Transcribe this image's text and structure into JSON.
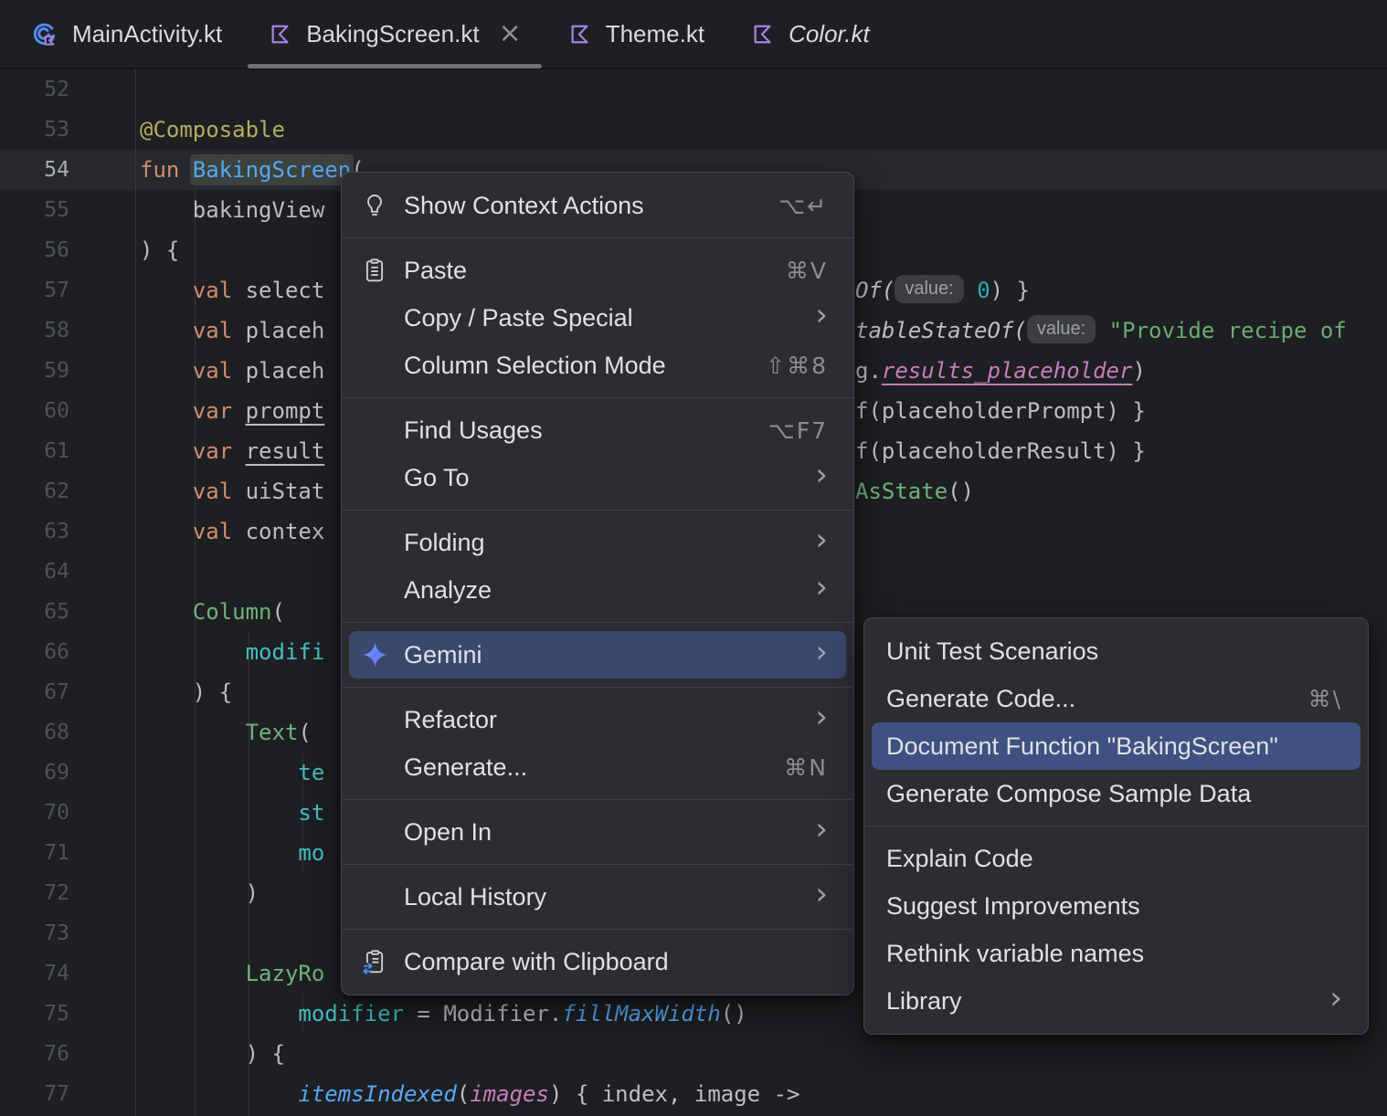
{
  "colors": {
    "editor_bg": "#1E1F22",
    "menu_bg": "#2B2D30",
    "menu_selection": "#39486B",
    "submenu_selection": "#3E5180",
    "caret_line": "#26282E",
    "kotlin_icon_purple": "#A182E3",
    "main_icon_blue": "#548AF7",
    "active_tab_underline": "#6E7278",
    "gemini_gradient": [
      "#8FB0FF",
      "#5E7CF7",
      "#9C7CF6"
    ],
    "keyword_orange": "#CF8E6D",
    "function_blue": "#56A8F5",
    "string_green": "#6AAB73",
    "named_arg_teal": "#43BFC0",
    "annotation_yellow": "#B3AE60",
    "reference_pink": "#C77DBB"
  },
  "tabs": [
    {
      "label": "MainActivity.kt",
      "icon": "kotlin-main",
      "active": false,
      "italic": false,
      "closable": false
    },
    {
      "label": "BakingScreen.kt",
      "icon": "kotlin-file",
      "active": true,
      "italic": false,
      "closable": true
    },
    {
      "label": "Theme.kt",
      "icon": "kotlin-file",
      "active": false,
      "italic": false,
      "closable": false
    },
    {
      "label": "Color.kt",
      "icon": "kotlin-file",
      "active": false,
      "italic": true,
      "closable": false
    }
  ],
  "editor": {
    "caret_line_number": "54",
    "inlay_hint": "value:",
    "lines": [
      {
        "n": "52",
        "segs": []
      },
      {
        "n": "53",
        "segs": [
          {
            "t": "@Composable",
            "s": "ann"
          }
        ]
      },
      {
        "n": "54",
        "caret": true,
        "segs": [
          {
            "t": "fun ",
            "s": "kw"
          },
          {
            "t": "BakingScreen",
            "s": "fn",
            "hl": true
          },
          {
            "t": "(",
            "s": "pln"
          }
        ]
      },
      {
        "n": "55",
        "segs": [
          {
            "t": "    bakingView",
            "s": "pln"
          }
        ]
      },
      {
        "n": "56",
        "segs": [
          {
            "t": ") {",
            "s": "pln"
          }
        ]
      },
      {
        "n": "57",
        "segs": [
          {
            "t": "    ",
            "s": "pln"
          },
          {
            "t": "val",
            "s": "kw"
          },
          {
            "t": " select",
            "s": "pln"
          }
        ],
        "right": [
          {
            "t": "Of(",
            "s": "itl"
          },
          {
            "chip": "value:"
          },
          {
            "t": " ",
            "s": "pln"
          },
          {
            "t": "0",
            "s": "num"
          },
          {
            "t": ") }",
            "s": "pln"
          }
        ]
      },
      {
        "n": "58",
        "segs": [
          {
            "t": "    ",
            "s": "pln"
          },
          {
            "t": "val",
            "s": "kw"
          },
          {
            "t": " placeh",
            "s": "pln"
          }
        ],
        "right": [
          {
            "t": "tableStateOf(",
            "s": "itl"
          },
          {
            "chip": "value:"
          },
          {
            "t": " ",
            "s": "pln"
          },
          {
            "t": "\"Provide recipe of",
            "s": "str"
          }
        ]
      },
      {
        "n": "59",
        "segs": [
          {
            "t": "    ",
            "s": "pln"
          },
          {
            "t": "val",
            "s": "kw"
          },
          {
            "t": " placeh",
            "s": "pln"
          }
        ],
        "right": [
          {
            "t": "g.",
            "s": "pln"
          },
          {
            "t": "results_placeholder",
            "s": "pinku"
          },
          {
            "t": ")",
            "s": "pln"
          }
        ]
      },
      {
        "n": "60",
        "segs": [
          {
            "t": "    ",
            "s": "pln"
          },
          {
            "t": "var",
            "s": "kw"
          },
          {
            "t": " ",
            "s": "pln"
          },
          {
            "t": "prompt",
            "s": "plnu"
          }
        ],
        "right": [
          {
            "t": "f(placeholderPrompt) }",
            "s": "pln"
          }
        ]
      },
      {
        "n": "61",
        "segs": [
          {
            "t": "    ",
            "s": "pln"
          },
          {
            "t": "var",
            "s": "kw"
          },
          {
            "t": " ",
            "s": "pln"
          },
          {
            "t": "result",
            "s": "plnu"
          }
        ],
        "right": [
          {
            "t": "f(placeholderResult) }",
            "s": "pln"
          }
        ]
      },
      {
        "n": "62",
        "segs": [
          {
            "t": "    ",
            "s": "pln"
          },
          {
            "t": "val",
            "s": "kw"
          },
          {
            "t": " uiStat",
            "s": "pln"
          }
        ],
        "right": [
          {
            "t": "AsState",
            "s": "comp"
          },
          {
            "t": "()",
            "s": "pln"
          }
        ]
      },
      {
        "n": "63",
        "segs": [
          {
            "t": "    ",
            "s": "pln"
          },
          {
            "t": "val",
            "s": "kw"
          },
          {
            "t": " contex",
            "s": "pln"
          }
        ]
      },
      {
        "n": "64",
        "segs": []
      },
      {
        "n": "65",
        "segs": [
          {
            "t": "    ",
            "s": "pln"
          },
          {
            "t": "Column",
            "s": "comp"
          },
          {
            "t": "(",
            "s": "pln"
          }
        ]
      },
      {
        "n": "66",
        "segs": [
          {
            "t": "        ",
            "s": "pln"
          },
          {
            "t": "modifi",
            "s": "named"
          }
        ]
      },
      {
        "n": "67",
        "segs": [
          {
            "t": "    ) {",
            "s": "pln"
          }
        ]
      },
      {
        "n": "68",
        "segs": [
          {
            "t": "        ",
            "s": "pln"
          },
          {
            "t": "Text",
            "s": "comp"
          },
          {
            "t": "(",
            "s": "pln"
          }
        ]
      },
      {
        "n": "69",
        "segs": [
          {
            "t": "            ",
            "s": "pln"
          },
          {
            "t": "te",
            "s": "named"
          }
        ]
      },
      {
        "n": "70",
        "segs": [
          {
            "t": "            ",
            "s": "pln"
          },
          {
            "t": "st",
            "s": "named"
          }
        ]
      },
      {
        "n": "71",
        "segs": [
          {
            "t": "            ",
            "s": "pln"
          },
          {
            "t": "mo",
            "s": "named"
          }
        ]
      },
      {
        "n": "72",
        "segs": [
          {
            "t": "        )",
            "s": "pln"
          }
        ]
      },
      {
        "n": "73",
        "segs": []
      },
      {
        "n": "74",
        "segs": [
          {
            "t": "        ",
            "s": "pln"
          },
          {
            "t": "LazyRo",
            "s": "comp"
          }
        ]
      },
      {
        "n": "75",
        "segs": [
          {
            "t": "            ",
            "s": "pln"
          },
          {
            "t": "modifier",
            "s": "named"
          },
          {
            "t": " = Modifier.",
            "s": "pln"
          },
          {
            "t": "fillMaxWidth",
            "s": "ext"
          },
          {
            "t": "()",
            "s": "pln"
          }
        ]
      },
      {
        "n": "76",
        "segs": [
          {
            "t": "        ) {",
            "s": "pln"
          }
        ]
      },
      {
        "n": "77",
        "segs": [
          {
            "t": "            ",
            "s": "pln"
          },
          {
            "t": "itemsIndexed",
            "s": "ext"
          },
          {
            "t": "(",
            "s": "pln"
          },
          {
            "t": "images",
            "s": "pink"
          },
          {
            "t": ") { index, image ->",
            "s": "pln"
          }
        ]
      }
    ]
  },
  "context_menu": {
    "items": [
      {
        "type": "item",
        "label": "Show Context Actions",
        "icon": "lightbulb",
        "shortcut": "⌥↵"
      },
      {
        "type": "sep"
      },
      {
        "type": "item",
        "label": "Paste",
        "icon": "clipboard",
        "shortcut": "⌘V"
      },
      {
        "type": "item",
        "label": "Copy / Paste Special",
        "submenu": true
      },
      {
        "type": "item",
        "label": "Column Selection Mode",
        "shortcut": "⇧⌘8"
      },
      {
        "type": "sep"
      },
      {
        "type": "item",
        "label": "Find Usages",
        "shortcut": "⌥F7"
      },
      {
        "type": "item",
        "label": "Go To",
        "submenu": true
      },
      {
        "type": "sep"
      },
      {
        "type": "item",
        "label": "Folding",
        "submenu": true
      },
      {
        "type": "item",
        "label": "Analyze",
        "submenu": true
      },
      {
        "type": "sep"
      },
      {
        "type": "item",
        "label": "Gemini",
        "icon": "gemini",
        "submenu": true,
        "selected": true
      },
      {
        "type": "sep"
      },
      {
        "type": "item",
        "label": "Refactor",
        "submenu": true
      },
      {
        "type": "item",
        "label": "Generate...",
        "shortcut": "⌘N"
      },
      {
        "type": "sep"
      },
      {
        "type": "item",
        "label": "Open In",
        "submenu": true
      },
      {
        "type": "sep"
      },
      {
        "type": "item",
        "label": "Local History",
        "submenu": true
      },
      {
        "type": "sep"
      },
      {
        "type": "item",
        "label": "Compare with Clipboard",
        "icon": "clipboard-compare"
      }
    ]
  },
  "gemini_submenu": {
    "items": [
      {
        "type": "item",
        "label": "Unit Test Scenarios"
      },
      {
        "type": "item",
        "label": "Generate Code...",
        "shortcut": "⌘\\"
      },
      {
        "type": "item",
        "label": "Document Function \"BakingScreen\"",
        "selected": true
      },
      {
        "type": "item",
        "label": "Generate Compose Sample Data"
      },
      {
        "type": "sep"
      },
      {
        "type": "item",
        "label": "Explain Code"
      },
      {
        "type": "item",
        "label": "Suggest Improvements"
      },
      {
        "type": "item",
        "label": "Rethink variable names"
      },
      {
        "type": "item",
        "label": "Library",
        "submenu": true
      }
    ]
  }
}
